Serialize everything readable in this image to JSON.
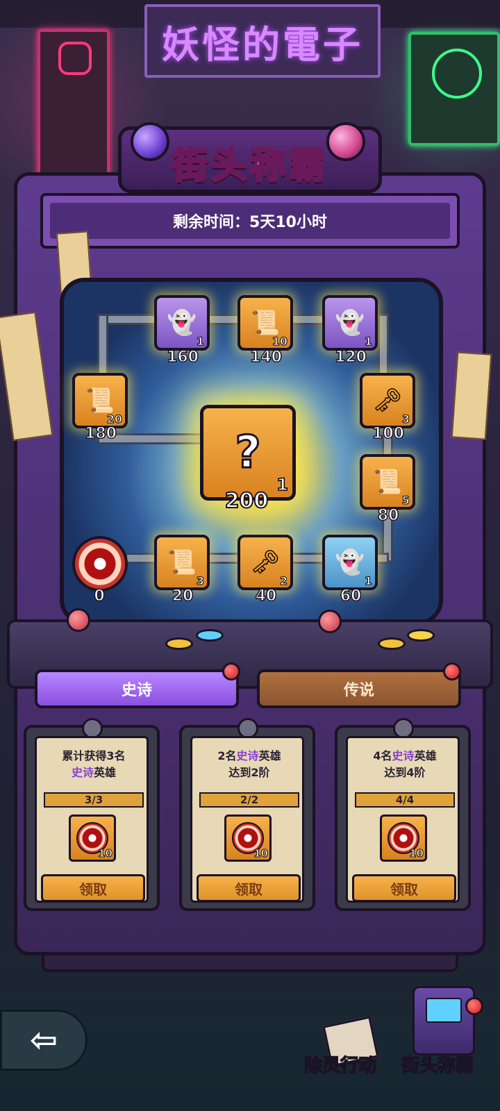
{
  "background": {
    "neon_sign_top": "妖怪的電子"
  },
  "event": {
    "title": "街头称霸",
    "time_label": "剩余时间：5天10小时"
  },
  "board": {
    "start": {
      "score": "0",
      "icon": "eye-orb-icon"
    },
    "center": {
      "glyph": "?",
      "qty": "1",
      "score": "200",
      "icon": "mystery-chest-icon"
    },
    "slots": [
      {
        "id": "s20",
        "color": "orange",
        "icon": "scroll-icon",
        "glyph": "📜",
        "qty": "3",
        "score": "20"
      },
      {
        "id": "s40",
        "color": "orange",
        "icon": "key-icon",
        "glyph": "🗝",
        "qty": "2",
        "score": "40"
      },
      {
        "id": "s60",
        "color": "blue",
        "icon": "spirit-bag-icon",
        "glyph": "👻",
        "qty": "1",
        "score": "60"
      },
      {
        "id": "s80",
        "color": "orange",
        "icon": "scroll-icon",
        "glyph": "📜",
        "qty": "5",
        "score": "80"
      },
      {
        "id": "s100",
        "color": "orange",
        "icon": "key-icon",
        "glyph": "🗝",
        "qty": "3",
        "score": "100"
      },
      {
        "id": "s120",
        "color": "purple",
        "icon": "spirit-bag-icon",
        "glyph": "👻",
        "qty": "1",
        "score": "120"
      },
      {
        "id": "s140",
        "color": "orange",
        "icon": "scroll-icon",
        "glyph": "📜",
        "qty": "10",
        "score": "140"
      },
      {
        "id": "s160",
        "color": "purple",
        "icon": "spirit-bag-icon",
        "glyph": "👻",
        "qty": "1",
        "score": "160"
      },
      {
        "id": "s180",
        "color": "orange",
        "icon": "scroll-icon",
        "glyph": "📜",
        "qty": "20",
        "score": "180"
      }
    ]
  },
  "tabs": [
    {
      "label": "史诗",
      "active": true,
      "badge": true
    },
    {
      "label": "传说",
      "active": false,
      "badge": true
    }
  ],
  "missions": [
    {
      "line1": "累计获得3名",
      "line2_hl": "史诗",
      "line2_rest": "英雄",
      "progress": "3/3",
      "progress_fraction": 1.0,
      "reward_qty": "10",
      "reward_icon": "eye-orb-icon",
      "claim": "领取"
    },
    {
      "line1_pre": "2名",
      "line1_hl": "史诗",
      "line1_post": "英雄",
      "line2": "达到2阶",
      "progress": "2/2",
      "progress_fraction": 1.0,
      "reward_qty": "10",
      "reward_icon": "eye-orb-icon",
      "claim": "领取"
    },
    {
      "line1_pre": "4名",
      "line1_hl": "史诗",
      "line1_post": "英雄",
      "line2": "达到4阶",
      "progress": "4/4",
      "progress_fraction": 1.0,
      "reward_qty": "10",
      "reward_icon": "eye-orb-icon",
      "claim": "领取"
    }
  ],
  "nav": {
    "back_icon": "back-arrow-icon",
    "back_glyph": "⇦",
    "items": [
      {
        "label": "除灵行动",
        "icon": "cards-icon"
      },
      {
        "label": "街头称霸",
        "icon": "arcade-icon",
        "badge": true
      }
    ]
  },
  "colors": {
    "cabinet": "#5e3b8f",
    "epic_tab": "#b887ff",
    "legend_tab": "#b0713f",
    "highlight_text": "#8a3fd6"
  }
}
